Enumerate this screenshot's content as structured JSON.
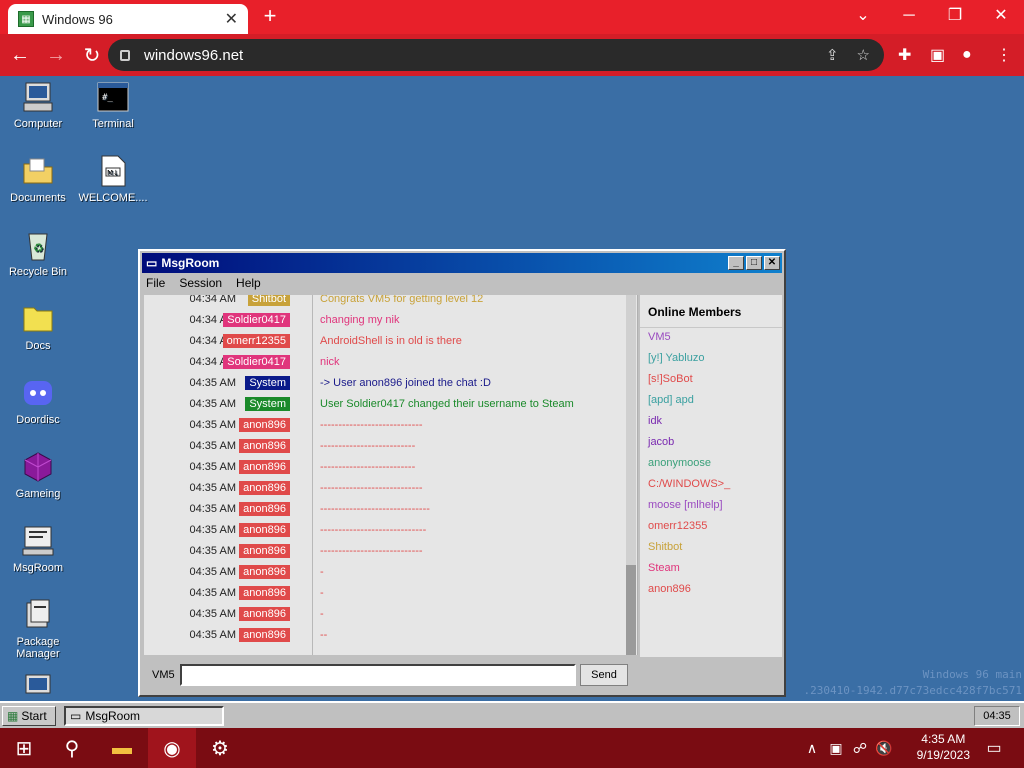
{
  "browser": {
    "tab_title": "Windows 96",
    "url": "windows96.net",
    "new_tab_icon": "+",
    "controls": [
      "⌄",
      "─",
      "❐",
      "✕"
    ]
  },
  "desktop": {
    "icons": [
      {
        "label": "Computer",
        "icon": "computer-icon"
      },
      {
        "label": "Terminal",
        "icon": "terminal-icon"
      },
      {
        "label": "Documents",
        "icon": "folder-documents-icon"
      },
      {
        "label": "WELCOME....",
        "icon": "markdown-file-icon"
      },
      {
        "label": "Recycle Bin",
        "icon": "recycle-bin-icon"
      },
      {
        "label": "Docs",
        "icon": "folder-icon"
      },
      {
        "label": "Doordisc",
        "icon": "doordisc-icon"
      },
      {
        "label": "Gameing",
        "icon": "game-cube-icon"
      },
      {
        "label": "MsgRoom",
        "icon": "msgroom-icon"
      },
      {
        "label": "Package Manager",
        "icon": "package-icon"
      }
    ],
    "watermark_line1": "Windows 96 main",
    "watermark_line2": ".230410-1942.d77c73edcc428f7bc571"
  },
  "window": {
    "title": "MsgRoom",
    "menu": [
      "File",
      "Session",
      "Help"
    ],
    "messages": [
      {
        "time": "04:34 AM",
        "user": "Shitbot",
        "user_color": "#c8a23a",
        "text": "Congrats VM5 for getting level 12",
        "text_color": "#c8a23a"
      },
      {
        "time": "04:34 AM",
        "user": "Soldier0417",
        "user_color": "#e0357c",
        "text": "changing my nik",
        "text_color": "#e0357c"
      },
      {
        "time": "04:34 AM",
        "user": "omerr12355",
        "user_color": "#e04a4a",
        "text": "AndroidShell is in old is there",
        "text_color": "#e04a4a"
      },
      {
        "time": "04:34 AM",
        "user": "Soldier0417",
        "user_color": "#e0357c",
        "text": "nick",
        "text_color": "#e0357c"
      },
      {
        "time": "04:35 AM",
        "user": "System",
        "user_color": "#0a1a8a",
        "text": "-> User anon896 joined the chat :D",
        "text_color": "#1a1a8a"
      },
      {
        "time": "04:35 AM",
        "user": "System",
        "user_color": "#1a8a2a",
        "text": "User Soldier0417 changed their username to Steam",
        "text_color": "#1a8a2a"
      },
      {
        "time": "04:35 AM",
        "user": "anon896",
        "user_color": "#e04a4a",
        "text": "----------------------------",
        "text_color": "#e04a4a"
      },
      {
        "time": "04:35 AM",
        "user": "anon896",
        "user_color": "#e04a4a",
        "text": "--------------------------",
        "text_color": "#e04a4a"
      },
      {
        "time": "04:35 AM",
        "user": "anon896",
        "user_color": "#e04a4a",
        "text": "--------------------------",
        "text_color": "#e04a4a"
      },
      {
        "time": "04:35 AM",
        "user": "anon896",
        "user_color": "#e04a4a",
        "text": "----------------------------",
        "text_color": "#e04a4a"
      },
      {
        "time": "04:35 AM",
        "user": "anon896",
        "user_color": "#e04a4a",
        "text": "------------------------------",
        "text_color": "#e04a4a"
      },
      {
        "time": "04:35 AM",
        "user": "anon896",
        "user_color": "#e04a4a",
        "text": "-----------------------------",
        "text_color": "#e04a4a"
      },
      {
        "time": "04:35 AM",
        "user": "anon896",
        "user_color": "#e04a4a",
        "text": "----------------------------",
        "text_color": "#e04a4a"
      },
      {
        "time": "04:35 AM",
        "user": "anon896",
        "user_color": "#e04a4a",
        "text": "-",
        "text_color": "#e04a4a"
      },
      {
        "time": "04:35 AM",
        "user": "anon896",
        "user_color": "#e04a4a",
        "text": "-",
        "text_color": "#e04a4a"
      },
      {
        "time": "04:35 AM",
        "user": "anon896",
        "user_color": "#e04a4a",
        "text": "-",
        "text_color": "#e04a4a"
      },
      {
        "time": "04:35 AM",
        "user": "anon896",
        "user_color": "#e04a4a",
        "text": "--",
        "text_color": "#e04a4a"
      }
    ],
    "members_title": "Online Members",
    "members": [
      {
        "name": "VM5",
        "color": "#9a4ac0"
      },
      {
        "name": "[y!] Yabluzo",
        "color": "#3aa0a0"
      },
      {
        "name": "[s!]SoBot",
        "color": "#e04a4a"
      },
      {
        "name": "[apd] apd",
        "color": "#3aa0a0"
      },
      {
        "name": "idk",
        "color": "#7a2ab0"
      },
      {
        "name": "jacob",
        "color": "#7a2ab0"
      },
      {
        "name": "anonymoose",
        "color": "#3aa07a"
      },
      {
        "name": "C:/WINDOWS>_",
        "color": "#e04a4a"
      },
      {
        "name": "moose [mlhelp]",
        "color": "#9a4ac0"
      },
      {
        "name": "omerr12355",
        "color": "#e04a4a"
      },
      {
        "name": "Shitbot",
        "color": "#c8a23a"
      },
      {
        "name": "Steam",
        "color": "#e0357c"
      },
      {
        "name": "anon896",
        "color": "#e04a4a"
      }
    ],
    "input_label": "VM5",
    "input_value": "",
    "send_label": "Send"
  },
  "w96_taskbar": {
    "start_label": "Start",
    "task_label": "MsgRoom",
    "clock": "04:35"
  },
  "win10_taskbar": {
    "time": "4:35 AM",
    "date": "9/19/2023"
  }
}
